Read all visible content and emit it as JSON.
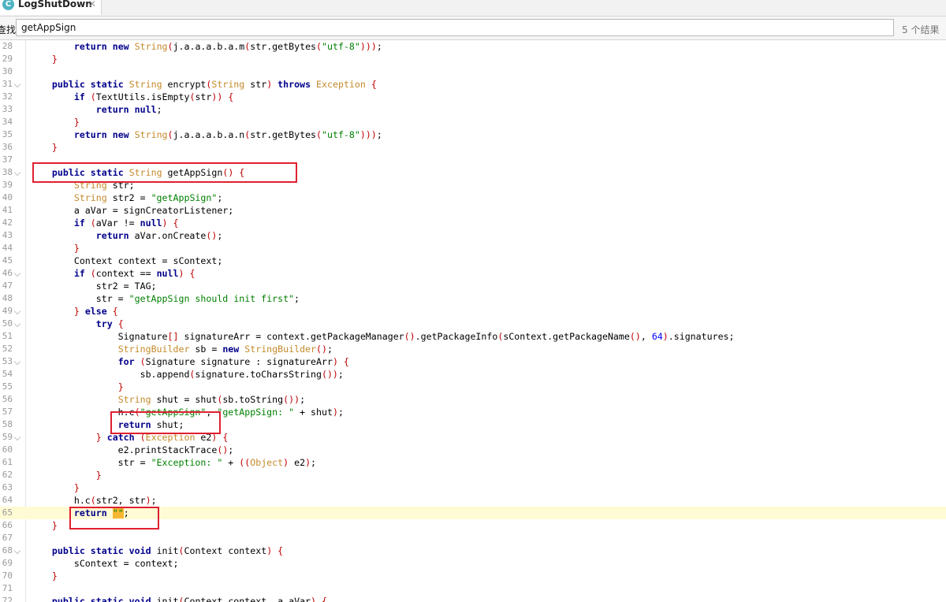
{
  "tab": {
    "title": "LogShutDown",
    "icon_letter": "C",
    "icon": "class-icon",
    "close_glyph": "✕"
  },
  "find": {
    "label": "查找:",
    "query": "getAppSign",
    "result": "5 个结果"
  },
  "highlight_color": "#e02030",
  "current_line": "65",
  "code_lines": [
    {
      "n": "28",
      "t": "        return new String(j.a.a.a.b.a.m(str.getBytes(\"utf-8\")));"
    },
    {
      "n": "29",
      "t": "    }"
    },
    {
      "n": "30",
      "t": ""
    },
    {
      "n": "31",
      "t": "    public static String encrypt(String str) throws Exception {"
    },
    {
      "n": "32",
      "t": "        if (TextUtils.isEmpty(str)) {"
    },
    {
      "n": "33",
      "t": "            return null;"
    },
    {
      "n": "34",
      "t": "        }"
    },
    {
      "n": "35",
      "t": "        return new String(j.a.a.a.b.a.n(str.getBytes(\"utf-8\")));"
    },
    {
      "n": "36",
      "t": "    }"
    },
    {
      "n": "37",
      "t": ""
    },
    {
      "n": "38",
      "t": "    public static String getAppSign() {"
    },
    {
      "n": "39",
      "t": "        String str;"
    },
    {
      "n": "40",
      "t": "        String str2 = \"getAppSign\";"
    },
    {
      "n": "41",
      "t": "        a aVar = signCreatorListener;"
    },
    {
      "n": "42",
      "t": "        if (aVar != null) {"
    },
    {
      "n": "43",
      "t": "            return aVar.onCreate();"
    },
    {
      "n": "44",
      "t": "        }"
    },
    {
      "n": "45",
      "t": "        Context context = sContext;"
    },
    {
      "n": "46",
      "t": "        if (context == null) {"
    },
    {
      "n": "47",
      "t": "            str2 = TAG;"
    },
    {
      "n": "48",
      "t": "            str = \"getAppSign should init first\";"
    },
    {
      "n": "49",
      "t": "        } else {"
    },
    {
      "n": "50",
      "t": "            try {"
    },
    {
      "n": "51",
      "t": "                Signature[] signatureArr = context.getPackageManager().getPackageInfo(sContext.getPackageName(), 64).signatures;"
    },
    {
      "n": "52",
      "t": "                StringBuilder sb = new StringBuilder();"
    },
    {
      "n": "53",
      "t": "                for (Signature signature : signatureArr) {"
    },
    {
      "n": "54",
      "t": "                    sb.append(signature.toCharsString());"
    },
    {
      "n": "55",
      "t": "                }"
    },
    {
      "n": "56",
      "t": "                String shut = shut(sb.toString());"
    },
    {
      "n": "57",
      "t": "                h.c(\"getAppSign\", \"getAppSign: \" + shut);"
    },
    {
      "n": "58",
      "t": "                return shut;"
    },
    {
      "n": "59",
      "t": "            } catch (Exception e2) {"
    },
    {
      "n": "60",
      "t": "                e2.printStackTrace();"
    },
    {
      "n": "61",
      "t": "                str = \"Exception: \" + ((Object) e2);"
    },
    {
      "n": "62",
      "t": "            }"
    },
    {
      "n": "63",
      "t": "        }"
    },
    {
      "n": "64",
      "t": "        h.c(str2, str);"
    },
    {
      "n": "65",
      "t": "        return \"\";"
    },
    {
      "n": "66",
      "t": "    }"
    },
    {
      "n": "67",
      "t": ""
    },
    {
      "n": "68",
      "t": "    public static void init(Context context) {"
    },
    {
      "n": "69",
      "t": "        sContext = context;"
    },
    {
      "n": "70",
      "t": "    }"
    },
    {
      "n": "71",
      "t": ""
    },
    {
      "n": "72",
      "t": "    public static void init(Context context, a aVar) {"
    }
  ]
}
